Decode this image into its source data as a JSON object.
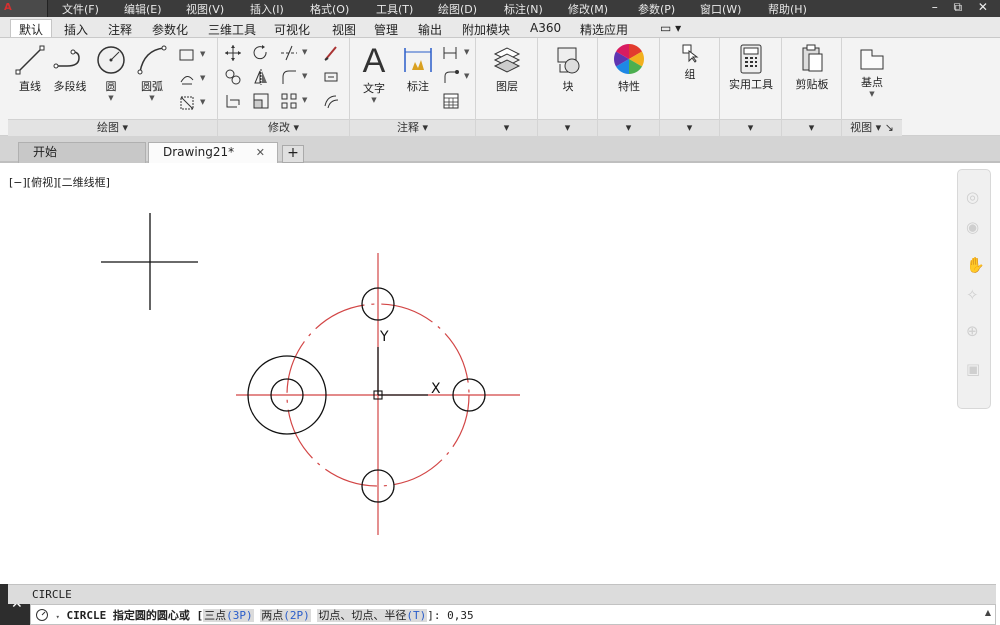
{
  "app_logo": "A",
  "menu": [
    "文件(F)",
    "编辑(E)",
    "视图(V)",
    "插入(I)",
    "格式(O)",
    "工具(T)",
    "绘图(D)",
    "标注(N)",
    "修改(M)",
    "参数(P)",
    "窗口(W)",
    "帮助(H)"
  ],
  "window_controls": "– ⧉ ✕",
  "ribbon_tabs": [
    "默认",
    "插入",
    "注释",
    "参数化",
    "三维工具",
    "可视化",
    "视图",
    "管理",
    "输出",
    "附加模块",
    "A360",
    "精选应用",
    "▭ ▾"
  ],
  "panels": {
    "draw": {
      "title": "绘图 ▾",
      "line": "直线",
      "polyline": "多段线",
      "circle": "圆",
      "arc": "圆弧"
    },
    "modify": {
      "title": "修改 ▾"
    },
    "annotation": {
      "title": "注释 ▾",
      "text": "文字",
      "dimension": "标注"
    },
    "layers": {
      "label": "图层"
    },
    "block": {
      "label": "块"
    },
    "properties": {
      "label": "特性"
    },
    "group": {
      "label": "组"
    },
    "utilities": {
      "label": "实用工具"
    },
    "clipboard": {
      "label": "剪贴板"
    },
    "view": {
      "label": "基点",
      "title": "视图 ▾ ↘"
    }
  },
  "doc_tabs": {
    "start": "开始",
    "drawing": "Drawing21*",
    "close": "✕",
    "add": "+"
  },
  "viewport_label": "[−][俯视][二维线框]",
  "ucs": {
    "y": "Y",
    "x": "X"
  },
  "command": {
    "history": "CIRCLE",
    "prefix": "CIRCLE 指定圆的圆心或 [",
    "opt1": "三点",
    "opt1_key": "(3P)",
    "opt2": "两点",
    "opt2_key": "(2P)",
    "opt3": "切点、切点、半径",
    "opt3_key": "(T)",
    "suffix": "]: 0,35",
    "close": "✕",
    "grip": "::::::",
    "scroll": "▲"
  }
}
